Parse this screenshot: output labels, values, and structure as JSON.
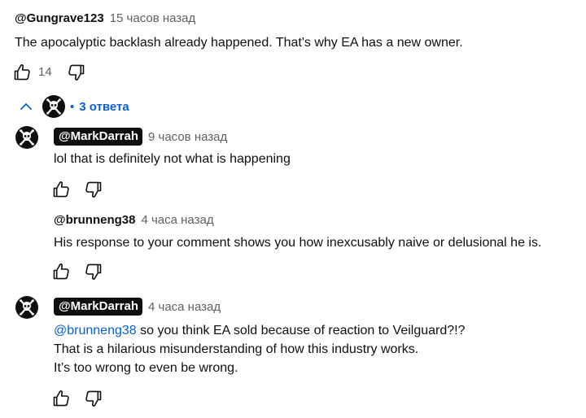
{
  "top_comment": {
    "author": "@Gungrave123",
    "time": "15 часов назад",
    "text": "The apocalyptic backlash already happened. That's why EA has a new owner.",
    "like_count": "14"
  },
  "replies_toggle": {
    "dot": "•",
    "label": "3 ответа"
  },
  "replies": [
    {
      "author": "@MarkDarrah",
      "time": "9 часов назад",
      "lines": [
        "lol that is definitely not what is happening"
      ]
    },
    {
      "author": "@brunneng38",
      "time": "4 часа назад",
      "lines": [
        "His response to your comment shows you how inexcusably naive or delusional he is."
      ]
    },
    {
      "author": "@MarkDarrah",
      "time": "4 часа назад",
      "mention": "@brunneng38",
      "lines": [
        "so you think EA sold because of reaction to Veilguard?!?",
        "That is a hilarious misunderstanding of how this industry works.",
        "It’s too wrong to even be wrong."
      ]
    }
  ],
  "icons": {
    "like": "thumbs-up-icon",
    "dislike": "thumbs-down-icon",
    "collapse": "chevron-up-icon",
    "avatar": "skull-crossbones-icon"
  }
}
